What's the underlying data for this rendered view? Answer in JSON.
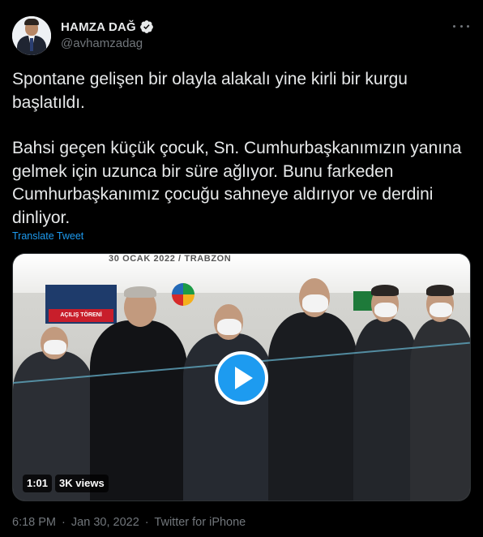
{
  "author": {
    "display_name": "HAMZA DAĞ",
    "handle": "@avhamzadag",
    "verified": true,
    "verified_icon": "verified-badge-icon",
    "avatar_icon": "avatar-photo"
  },
  "more_icon": "more-horizontal-icon",
  "tweet": {
    "paragraphs": [
      "Spontane gelişen bir olayla alakalı yine kirli bir kurgu başlatıldı.",
      "Bahsi geçen küçük çocuk, Sn. Cumhurbaşkanımızın yanına gelmek için uzunca bir süre ağlıyor. Bunu farkeden Cumhurbaşkanımız çocuğu sahneye aldırıyor ve derdini dinliyor."
    ],
    "translate_label": "Translate Tweet"
  },
  "media": {
    "banner_text": "30 OCAK 2022 / TRABZON",
    "sign_text": "AÇILIŞ TÖRENİ",
    "play_icon": "play-icon",
    "duration": "1:01",
    "views": "3K views"
  },
  "meta": {
    "time": "6:18 PM",
    "separator": "·",
    "date": "Jan 30, 2022",
    "source": "Twitter for iPhone"
  },
  "colors": {
    "background": "#000000",
    "text": "#e7e9ea",
    "secondary": "#71767b",
    "accent": "#1d9bf0"
  }
}
